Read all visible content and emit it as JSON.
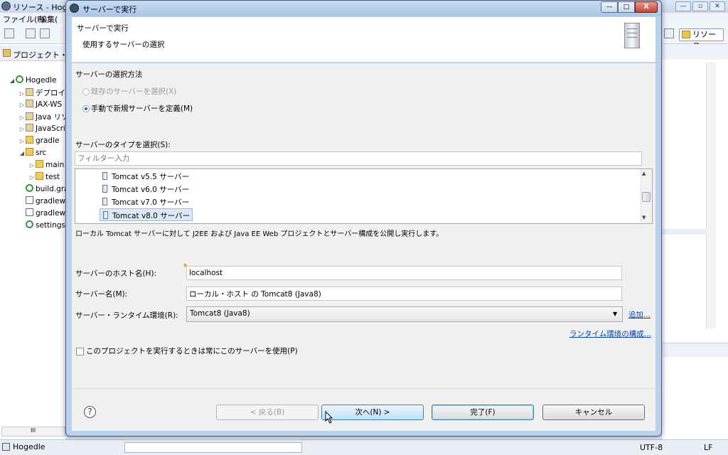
{
  "background": {
    "window_title": "リソース - Hoge",
    "menu": [
      "ファイル(F)",
      "編集("
    ],
    "perspective_label": "リソース",
    "project_tab": "プロジェクト・エ",
    "tree": [
      {
        "label": "Hogedle",
        "expand": "◢",
        "icon": "project-icon"
      },
      {
        "label": "デプロイ",
        "expand": "▷",
        "icon": "deploy-icon"
      },
      {
        "label": "JAX-WS",
        "expand": "▷",
        "icon": "jaxws-icon"
      },
      {
        "label": "Java リソ",
        "expand": "▷",
        "icon": "java-resources-icon"
      },
      {
        "label": "JavaScri",
        "expand": "▷",
        "icon": "javascript-icon"
      },
      {
        "label": "gradle",
        "expand": "▷",
        "icon": "folder-icon"
      },
      {
        "label": "src",
        "expand": "◢",
        "icon": "folder-icon"
      },
      {
        "label": "main",
        "expand": "▷",
        "icon": "folder-icon"
      },
      {
        "label": "test",
        "expand": "▷",
        "icon": "folder-icon"
      },
      {
        "label": "build.gra",
        "expand": "",
        "icon": "gradle-file-icon"
      },
      {
        "label": "gradlew",
        "expand": "",
        "icon": "file-icon"
      },
      {
        "label": "gradlew",
        "expand": "",
        "icon": "file-icon"
      },
      {
        "label": "settings",
        "expand": "",
        "icon": "gradle-file-icon"
      }
    ],
    "status_project": "Hogedle",
    "status_encoding": "UTF-8",
    "status_line_ending": "LF",
    "left_scroll_label": "III"
  },
  "dialog": {
    "title": "サーバーで実行",
    "header_title": "サーバーで実行",
    "header_description": "使用するサーバーの選択",
    "selection_method_label": "サーバーの選択方法",
    "radio_existing": "既存のサーバーを選択(X)",
    "radio_manual": "手動で新規サーバーを定義(M)",
    "type_label": "サーバーのタイプを選択(S):",
    "filter_placeholder": "フィルター入力",
    "server_types": [
      "Tomcat v5.5 サーバー",
      "Tomcat v6.0 サーバー",
      "Tomcat v7.0 サーバー",
      "Tomcat v8.0 サーバー"
    ],
    "selected_server_type": "Tomcat v8.0 サーバー",
    "type_description": "ローカル Tomcat サーバーに対して J2EE および Java EE Web プロジェクトとサーバー構成を公開し実行します。",
    "host_label": "サーバーのホスト名(H):",
    "host_value": "localhost",
    "name_label": "サーバー名(M):",
    "name_value": "ローカル・ホスト の Tomcat8 (Java8)",
    "runtime_label": "サーバー・ランタイム環境(R):",
    "runtime_value": "Tomcat8 (Java8)",
    "add_link": "追加...",
    "runtime_config_link": "ランタイム環境の構成...",
    "always_use_label": "このプロジェクトを実行するときは常にこのサーバーを使用(P)",
    "buttons": {
      "back": "< 戻る(B)",
      "next": "次へ(N) >",
      "finish": "完了(F)",
      "cancel": "キャンセル"
    },
    "help_symbol": "?",
    "window_controls": {
      "minimize": "—",
      "maximize": "□",
      "close": "X"
    }
  }
}
